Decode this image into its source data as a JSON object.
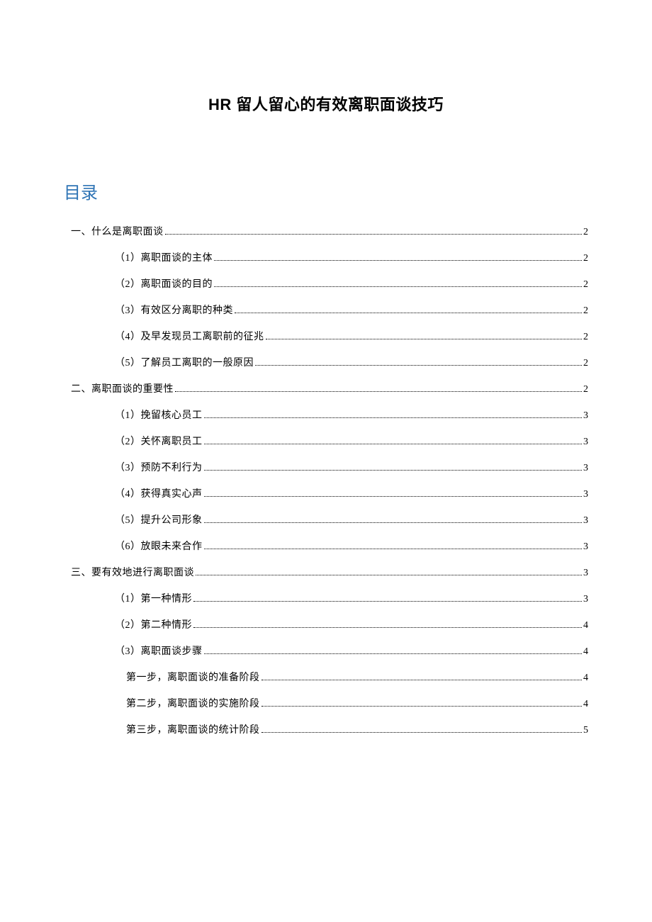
{
  "title": "HR 留人留心的有效离职面谈技巧",
  "toc_heading": "目录",
  "toc": [
    {
      "label": "一、什么是离职面谈",
      "page": "2",
      "level": 0
    },
    {
      "label": "（1）离职面谈的主体",
      "page": "2",
      "level": 1
    },
    {
      "label": "（2）离职面谈的目的",
      "page": "2",
      "level": 1
    },
    {
      "label": "（3）有效区分离职的种类",
      "page": "2",
      "level": 1
    },
    {
      "label": "（4）及早发现员工离职前的征兆",
      "page": "2",
      "level": 1
    },
    {
      "label": "（5）了解员工离职的一般原因",
      "page": "2",
      "level": 1
    },
    {
      "label": "二、离职面谈的重要性",
      "page": "2",
      "level": 0
    },
    {
      "label": "（1）挽留核心员工",
      "page": "3",
      "level": 1
    },
    {
      "label": "（2）关怀离职员工",
      "page": "3",
      "level": 1
    },
    {
      "label": "（3）预防不利行为",
      "page": "3",
      "level": 1
    },
    {
      "label": "（4）获得真实心声",
      "page": "3",
      "level": 1
    },
    {
      "label": "（5）提升公司形象",
      "page": "3",
      "level": 1
    },
    {
      "label": "（6）放眼未来合作",
      "page": "3",
      "level": 1
    },
    {
      "label": "三、要有效地进行离职面谈",
      "page": "3",
      "level": 0
    },
    {
      "label": "（1）第一种情形",
      "page": "3",
      "level": 1
    },
    {
      "label": "（2）第二种情形",
      "page": "4",
      "level": 1
    },
    {
      "label": "（3）离职面谈步骤",
      "page": "4",
      "level": 1
    },
    {
      "label": "第一步，离职面谈的准备阶段",
      "page": "4",
      "level": 2
    },
    {
      "label": "第二步，离职面谈的实施阶段",
      "page": "4",
      "level": 2
    },
    {
      "label": "第三步，离职面谈的统计阶段",
      "page": "5",
      "level": 2
    }
  ]
}
